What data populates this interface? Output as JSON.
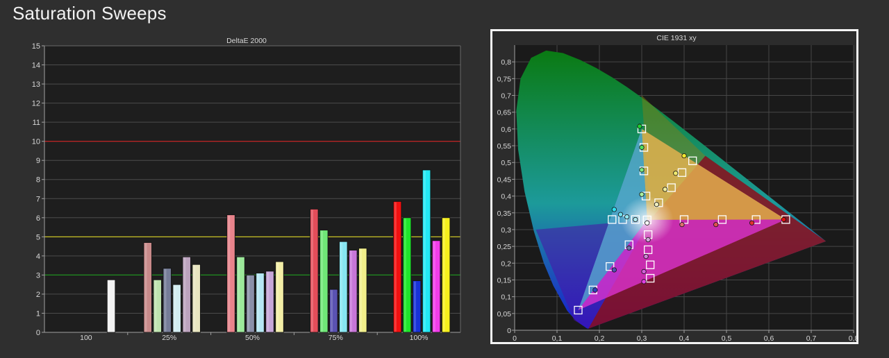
{
  "page": {
    "title": "Saturation Sweeps"
  },
  "chart_data": [
    {
      "type": "bar",
      "title": "DeltaE 2000",
      "ylim": [
        0,
        15
      ],
      "yticks": [
        0,
        1,
        2,
        3,
        4,
        5,
        6,
        7,
        8,
        9,
        10,
        11,
        12,
        13,
        14,
        15
      ],
      "reference_lines": [
        {
          "value": 10,
          "color": "#d02020"
        },
        {
          "value": 5,
          "color": "#d8d020"
        },
        {
          "value": 3,
          "color": "#1f8f1f"
        }
      ],
      "categories": [
        "100",
        "25%",
        "50%",
        "75%",
        "100%"
      ],
      "groups": [
        {
          "category": "100",
          "bars": [
            {
              "color": "white",
              "value": 2.75
            }
          ]
        },
        {
          "category": "25%",
          "bars": [
            {
              "color": "red",
              "value": 4.7
            },
            {
              "color": "green",
              "value": 2.75
            },
            {
              "color": "blue",
              "value": 3.35
            },
            {
              "color": "cyan",
              "value": 2.5
            },
            {
              "color": "magenta",
              "value": 3.95
            },
            {
              "color": "yellow",
              "value": 3.55
            }
          ]
        },
        {
          "category": "50%",
          "bars": [
            {
              "color": "red",
              "value": 6.15
            },
            {
              "color": "green",
              "value": 3.95
            },
            {
              "color": "blue",
              "value": 3.0
            },
            {
              "color": "cyan",
              "value": 3.1
            },
            {
              "color": "magenta",
              "value": 3.2
            },
            {
              "color": "yellow",
              "value": 3.7
            }
          ]
        },
        {
          "category": "75%",
          "bars": [
            {
              "color": "red",
              "value": 6.45
            },
            {
              "color": "green",
              "value": 5.35
            },
            {
              "color": "blue",
              "value": 2.25
            },
            {
              "color": "cyan",
              "value": 4.75
            },
            {
              "color": "magenta",
              "value": 4.3
            },
            {
              "color": "yellow",
              "value": 4.4
            }
          ]
        },
        {
          "category": "100%",
          "bars": [
            {
              "color": "red",
              "value": 6.85
            },
            {
              "color": "green",
              "value": 6.0
            },
            {
              "color": "blue",
              "value": 2.7
            },
            {
              "color": "cyan",
              "value": 8.5
            },
            {
              "color": "magenta",
              "value": 4.8
            },
            {
              "color": "yellow",
              "value": 6.0
            }
          ]
        }
      ],
      "bar_colors": {
        "white": [
          "#f2f2f2",
          "#f2f2f2",
          "#f2f2f2",
          "#f2f2f2",
          "#f2f2f2"
        ],
        "red": [
          "#ffffff",
          "#c98a8a",
          "#e8838b",
          "#e44d5a",
          "#f21010"
        ],
        "green": [
          "#ffffff",
          "#bfe4b0",
          "#9ce89a",
          "#6fe777",
          "#1de62a"
        ],
        "blue": [
          "#ffffff",
          "#767d98",
          "#8a8fa8",
          "#5a52b2",
          "#1832d8"
        ],
        "cyan": [
          "#ffffff",
          "#d2ecf1",
          "#b5e7f3",
          "#87e6f2",
          "#22e8f4"
        ],
        "magenta": [
          "#ffffff",
          "#bca3be",
          "#c6a6d8",
          "#c876d8",
          "#f23cea"
        ],
        "yellow": [
          "#ffffff",
          "#e9e6c0",
          "#f3eea6",
          "#f1ee8a",
          "#f6f01c"
        ]
      }
    },
    {
      "type": "scatter",
      "title": "CIE 1931 xy",
      "xlim": [
        0,
        0.8
      ],
      "ylim": [
        0,
        0.85
      ],
      "xticks": [
        "0",
        "0,1",
        "0,2",
        "0,3",
        "0,4",
        "0,5",
        "0,6",
        "0,7",
        "0,8"
      ],
      "xtick_values": [
        0,
        0.1,
        0.2,
        0.3,
        0.4,
        0.5,
        0.6,
        0.7,
        0.8
      ],
      "yticks": [
        "0",
        "0,05",
        "0,1",
        "0,15",
        "0,2",
        "0,25",
        "0,3",
        "0,35",
        "0,4",
        "0,45",
        "0,5",
        "0,55",
        "0,6",
        "0,65",
        "0,7",
        "0,75",
        "0,8"
      ],
      "ytick_values": [
        0,
        0.05,
        0.1,
        0.15,
        0.2,
        0.25,
        0.3,
        0.35,
        0.4,
        0.45,
        0.5,
        0.55,
        0.6,
        0.65,
        0.7,
        0.75,
        0.8
      ],
      "gamut_triangle": [
        [
          0.64,
          0.33
        ],
        [
          0.3,
          0.6
        ],
        [
          0.15,
          0.06
        ]
      ],
      "targets": [
        {
          "x": 0.3127,
          "y": 0.329
        },
        {
          "x": 0.4,
          "y": 0.33
        },
        {
          "x": 0.49,
          "y": 0.33
        },
        {
          "x": 0.57,
          "y": 0.33
        },
        {
          "x": 0.64,
          "y": 0.33
        },
        {
          "x": 0.31,
          "y": 0.4
        },
        {
          "x": 0.305,
          "y": 0.475
        },
        {
          "x": 0.305,
          "y": 0.545
        },
        {
          "x": 0.3,
          "y": 0.6
        },
        {
          "x": 0.27,
          "y": 0.255
        },
        {
          "x": 0.225,
          "y": 0.19
        },
        {
          "x": 0.185,
          "y": 0.12
        },
        {
          "x": 0.15,
          "y": 0.06
        },
        {
          "x": 0.285,
          "y": 0.33
        },
        {
          "x": 0.255,
          "y": 0.33
        },
        {
          "x": 0.23,
          "y": 0.33
        },
        {
          "x": 0.315,
          "y": 0.285
        },
        {
          "x": 0.315,
          "y": 0.24
        },
        {
          "x": 0.32,
          "y": 0.195
        },
        {
          "x": 0.32,
          "y": 0.155
        },
        {
          "x": 0.34,
          "y": 0.38
        },
        {
          "x": 0.37,
          "y": 0.425
        },
        {
          "x": 0.395,
          "y": 0.47
        },
        {
          "x": 0.42,
          "y": 0.505
        }
      ],
      "measured": [
        {
          "x": 0.3127,
          "y": 0.32,
          "color": "#ffffff"
        },
        {
          "x": 0.395,
          "y": 0.315,
          "color": "#e07070"
        },
        {
          "x": 0.475,
          "y": 0.315,
          "color": "#e05050"
        },
        {
          "x": 0.56,
          "y": 0.32,
          "color": "#e03030"
        },
        {
          "x": 0.635,
          "y": 0.33,
          "color": "#e01010"
        },
        {
          "x": 0.3,
          "y": 0.405,
          "color": "#a8f0a0"
        },
        {
          "x": 0.3,
          "y": 0.478,
          "color": "#7ae880"
        },
        {
          "x": 0.3,
          "y": 0.545,
          "color": "#50e060"
        },
        {
          "x": 0.295,
          "y": 0.608,
          "color": "#20d030"
        },
        {
          "x": 0.27,
          "y": 0.245,
          "color": "#7070a8"
        },
        {
          "x": 0.235,
          "y": 0.18,
          "color": "#5050b0"
        },
        {
          "x": 0.19,
          "y": 0.12,
          "color": "#3040c0"
        },
        {
          "x": 0.285,
          "y": 0.33,
          "color": "#b0eaf0"
        },
        {
          "x": 0.265,
          "y": 0.338,
          "color": "#90e4ef"
        },
        {
          "x": 0.25,
          "y": 0.345,
          "color": "#70e0ee"
        },
        {
          "x": 0.235,
          "y": 0.36,
          "color": "#30e0f0"
        },
        {
          "x": 0.315,
          "y": 0.27,
          "color": "#d0a8d8"
        },
        {
          "x": 0.31,
          "y": 0.22,
          "color": "#d080d8"
        },
        {
          "x": 0.305,
          "y": 0.175,
          "color": "#d060d8"
        },
        {
          "x": 0.305,
          "y": 0.145,
          "color": "#e040e0"
        },
        {
          "x": 0.335,
          "y": 0.375,
          "color": "#f0eec0"
        },
        {
          "x": 0.355,
          "y": 0.42,
          "color": "#f0ec9a"
        },
        {
          "x": 0.38,
          "y": 0.468,
          "color": "#f0ea70"
        },
        {
          "x": 0.4,
          "y": 0.52,
          "color": "#f0e830"
        }
      ]
    }
  ]
}
